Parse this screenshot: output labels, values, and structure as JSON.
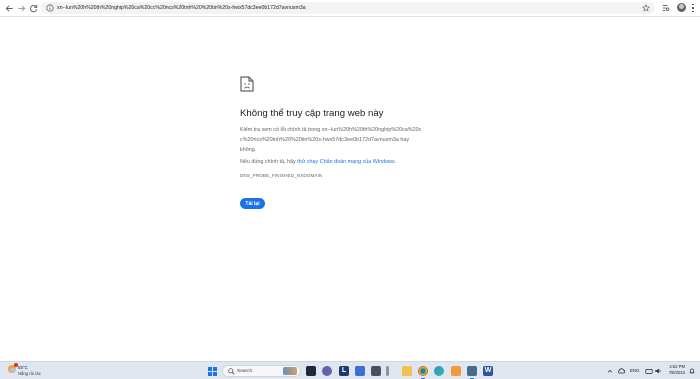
{
  "browser": {
    "url": "xn--lun%20h%20th%20nghip%20ca%20cc%20ncs%20tnh%20%20tin%20s-hwx57dc3ee0b172d7avnuxm3a",
    "icons": {
      "back": "arrow-left-icon",
      "forward": "arrow-right-icon",
      "reload": "reload-icon",
      "site_info": "info-icon",
      "bookmark": "star-icon",
      "extensions": "tab-search-icon",
      "downloads": "download-icon",
      "profile": "avatar",
      "menu": "more-vert-icon"
    }
  },
  "error_page": {
    "icon": "sad-document-icon",
    "title": "Không thể truy cập trang web này",
    "check_prefix": "Kiểm tra xem có lỗi chính tả trong",
    "url_text": "xn--lun%20h%20th%20nghip%20ca%20cc%20ncs%20tnh%20%20tin%20s-hwx57dc3ee0b172d7avnuxm3a",
    "check_suffix": "hay không.",
    "suggest_prefix": "Nếu đúng chính tả, hãy",
    "suggest_link": "thử chạy Chẩn đoán mạng của Windows",
    "suggest_suffix": ".",
    "error_code": "DNS_PROBE_FINISHED_NXDOMAIN",
    "reload_label": "Tải lại",
    "accent_color": "#1a73e8"
  },
  "taskbar": {
    "weather": {
      "temp": "55°C",
      "condition": "Nắng rải rác"
    },
    "search_placeholder": "Search",
    "language": "ENG",
    "time": "2:52 PM",
    "date": "7/8/2024",
    "apps": [
      "file-explorer-icon",
      "teams-chat-icon",
      "app-l-icon",
      "store-icon",
      "calculator-icon",
      "folder-icon",
      "chrome-icon",
      "edge-icon",
      "notes-icon",
      "settings-icon",
      "word-icon"
    ]
  }
}
